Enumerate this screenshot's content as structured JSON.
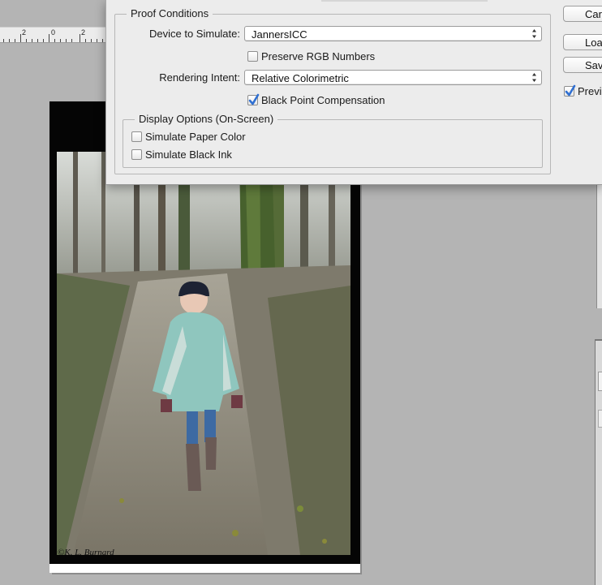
{
  "ruler": {
    "labels": [
      "2",
      "0",
      "2"
    ]
  },
  "dialog": {
    "proof_conditions": {
      "legend": "Proof Conditions",
      "device_label": "Device to Simulate:",
      "device_value": "JannersICC",
      "preserve_rgb_label": "Preserve RGB Numbers",
      "preserve_rgb_checked": false,
      "intent_label": "Rendering Intent:",
      "intent_value": "Relative Colorimetric",
      "bpc_label": "Black Point Compensation",
      "bpc_checked": true
    },
    "display_options": {
      "legend": "Display Options (On-Screen)",
      "paper_color_label": "Simulate Paper Color",
      "paper_color_checked": false,
      "black_ink_label": "Simulate Black Ink",
      "black_ink_checked": false
    },
    "buttons": {
      "cancel": "Car",
      "load": "Loa",
      "save": "Sav"
    },
    "preview": {
      "label": "Previ",
      "checked": true
    }
  },
  "document": {
    "watermark": "©K. L. Burnard"
  },
  "colors": {
    "check_accent": "#2f6fd1",
    "canvas_bg": "#b4b4b4",
    "dialog_bg": "#ececec"
  }
}
